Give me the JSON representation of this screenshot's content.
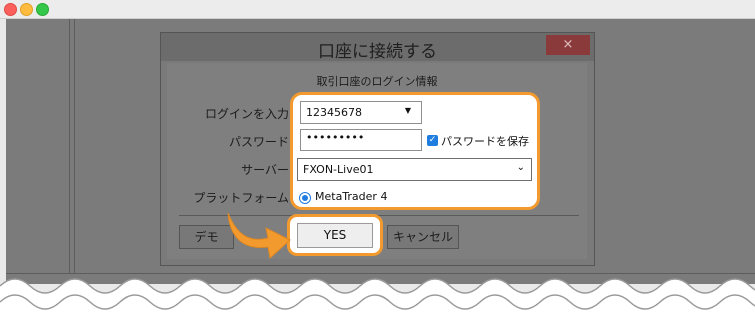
{
  "dialog": {
    "title": "口座に接続する",
    "close_label": "×",
    "subtitle": "取引口座のログイン情報",
    "labels": {
      "login": "ログインを入力",
      "password": "パスワード",
      "server": "サーバー",
      "platform": "プラットフォーム"
    },
    "login_value": "12345678",
    "password_value": "•••••••••",
    "save_password_label": "パスワードを保存",
    "save_password_checked": true,
    "server_value": "FXON-Live01",
    "platform_value": "MetaTrader 4",
    "buttons": {
      "demo": "デモ",
      "yes": "YES",
      "cancel": "キャンセル"
    }
  },
  "colors": {
    "highlight": "#f39a2f",
    "checkbox": "#1e7ddf"
  }
}
